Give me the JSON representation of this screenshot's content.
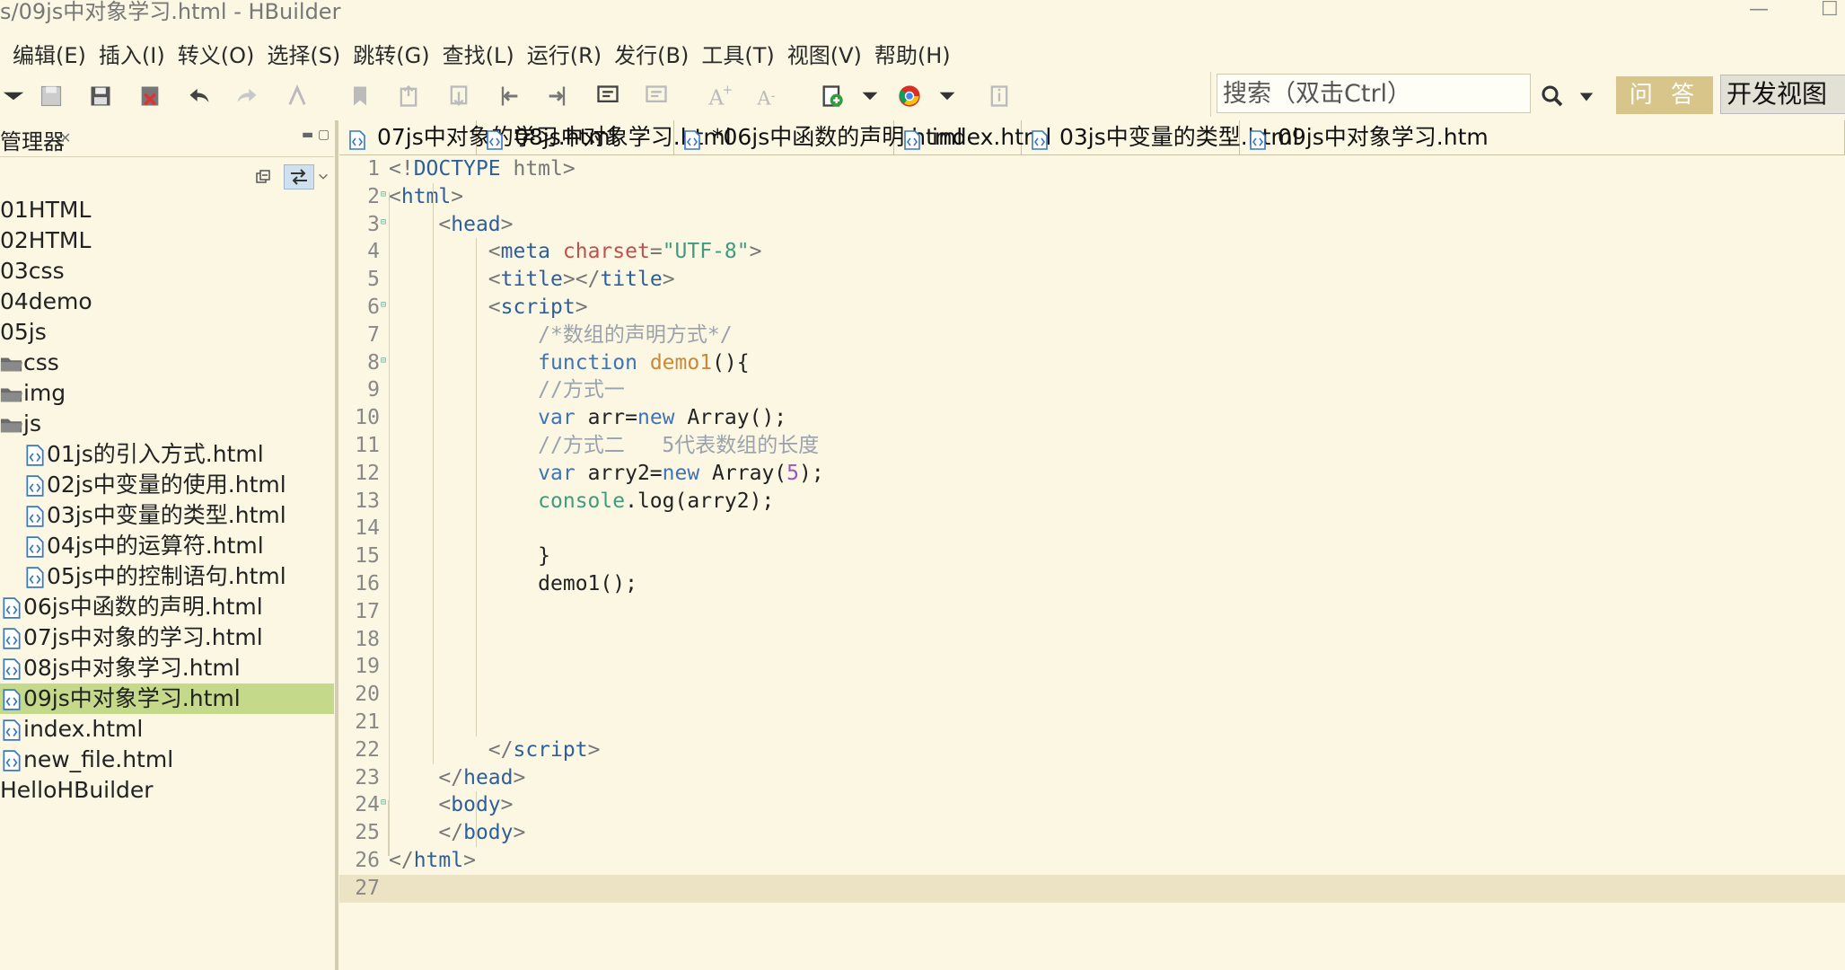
{
  "window": {
    "title": "s/09js中对象学习.html  -  HBuilder",
    "minimize": "—",
    "maximize": "☐"
  },
  "menu": [
    "编辑(E)",
    "插入(I)",
    "转义(O)",
    "选择(S)",
    "跳转(G)",
    "查找(L)",
    "运行(R)",
    "发行(B)",
    "工具(T)",
    "视图(V)",
    "帮助(H)"
  ],
  "toolbar": {
    "search_placeholder": "搜索（双击Ctrl）",
    "ask_label": "问 答",
    "devview_label": "开发视图"
  },
  "project_panel": {
    "title": "管理器",
    "close": "✕",
    "items": [
      {
        "label": "01HTML",
        "type": "project",
        "indent": 0
      },
      {
        "label": "02HTML",
        "type": "project",
        "indent": 0
      },
      {
        "label": "03css",
        "type": "project",
        "indent": 0
      },
      {
        "label": "04demo",
        "type": "project",
        "indent": 0
      },
      {
        "label": "05js",
        "type": "project",
        "indent": 0
      },
      {
        "label": "css",
        "type": "folder",
        "indent": 1
      },
      {
        "label": "img",
        "type": "folder",
        "indent": 1
      },
      {
        "label": "js",
        "type": "folder",
        "indent": 1
      },
      {
        "label": "01js的引入方式.html",
        "type": "file",
        "indent": 2
      },
      {
        "label": "02js中变量的使用.html",
        "type": "file",
        "indent": 2
      },
      {
        "label": "03js中变量的类型.html",
        "type": "file",
        "indent": 2
      },
      {
        "label": "04js中的运算符.html",
        "type": "file",
        "indent": 2
      },
      {
        "label": "05js中的控制语句.html",
        "type": "file",
        "indent": 2
      },
      {
        "label": "06js中函数的声明.html",
        "type": "file",
        "indent": 1
      },
      {
        "label": "07js中对象的学习.html",
        "type": "file",
        "indent": 1
      },
      {
        "label": "08js中对象学习.html",
        "type": "file",
        "indent": 1
      },
      {
        "label": "09js中对象学习.html",
        "type": "file",
        "indent": 1,
        "selected": true
      },
      {
        "label": "index.html",
        "type": "file",
        "indent": 1
      },
      {
        "label": "new_file.html",
        "type": "file",
        "indent": 1
      },
      {
        "label": "HelloHBuilder",
        "type": "project",
        "indent": 0
      }
    ]
  },
  "tabs": [
    {
      "label": "07js中对象的学习.html"
    },
    {
      "label": "08js中对象学习.html"
    },
    {
      "label": "*06js中函数的声明.html"
    },
    {
      "label": "index.html"
    },
    {
      "label": "03js中变量的类型.html"
    },
    {
      "label": "09js中对象学习.htm"
    }
  ],
  "editor": {
    "current_line": 27,
    "lines": [
      {
        "n": "1",
        "fold": false,
        "tokens": [
          [
            "br",
            "<!"
          ],
          [
            "tag",
            "DOCTYPE"
          ],
          [
            "br",
            " html>"
          ]
        ]
      },
      {
        "n": "2",
        "fold": true,
        "tokens": [
          [
            "br",
            "<"
          ],
          [
            "tag",
            "html"
          ],
          [
            "br",
            ">"
          ]
        ]
      },
      {
        "n": "3",
        "fold": true,
        "tokens": [
          [
            "plain",
            "    "
          ],
          [
            "br",
            "<"
          ],
          [
            "tag",
            "head"
          ],
          [
            "br",
            ">"
          ]
        ]
      },
      {
        "n": "4",
        "fold": false,
        "tokens": [
          [
            "plain",
            "        "
          ],
          [
            "br",
            "<"
          ],
          [
            "tag",
            "meta"
          ],
          [
            "plain",
            " "
          ],
          [
            "attr",
            "charset"
          ],
          [
            "br",
            "="
          ],
          [
            "str",
            "\"UTF-8\""
          ],
          [
            "br",
            ">"
          ]
        ]
      },
      {
        "n": "5",
        "fold": false,
        "tokens": [
          [
            "plain",
            "        "
          ],
          [
            "br",
            "<"
          ],
          [
            "tag",
            "title"
          ],
          [
            "br",
            "></"
          ],
          [
            "tag",
            "title"
          ],
          [
            "br",
            ">"
          ]
        ]
      },
      {
        "n": "6",
        "fold": true,
        "tokens": [
          [
            "plain",
            "        "
          ],
          [
            "br",
            "<"
          ],
          [
            "tag",
            "script"
          ],
          [
            "br",
            ">"
          ]
        ]
      },
      {
        "n": "7",
        "fold": false,
        "tokens": [
          [
            "plain",
            "            "
          ],
          [
            "cm",
            "/*数组的声明方式*/"
          ]
        ]
      },
      {
        "n": "8",
        "fold": true,
        "tokens": [
          [
            "plain",
            "            "
          ],
          [
            "kw",
            "function"
          ],
          [
            "plain",
            " "
          ],
          [
            "fn",
            "demo1"
          ],
          [
            "plain",
            "(){"
          ]
        ]
      },
      {
        "n": "9",
        "fold": false,
        "tokens": [
          [
            "plain",
            "            "
          ],
          [
            "cm",
            "//方式一"
          ]
        ]
      },
      {
        "n": "10",
        "fold": false,
        "tokens": [
          [
            "plain",
            "            "
          ],
          [
            "kw",
            "var"
          ],
          [
            "plain",
            " arr="
          ],
          [
            "kw",
            "new"
          ],
          [
            "plain",
            " Array();"
          ]
        ]
      },
      {
        "n": "11",
        "fold": false,
        "tokens": [
          [
            "plain",
            "            "
          ],
          [
            "cm",
            "//方式二   5代表数组的长度"
          ]
        ]
      },
      {
        "n": "12",
        "fold": false,
        "tokens": [
          [
            "plain",
            "            "
          ],
          [
            "kw",
            "var"
          ],
          [
            "plain",
            " arry2="
          ],
          [
            "kw",
            "new"
          ],
          [
            "plain",
            " Array("
          ],
          [
            "num",
            "5"
          ],
          [
            "plain",
            ");"
          ]
        ]
      },
      {
        "n": "13",
        "fold": false,
        "tokens": [
          [
            "plain",
            "            "
          ],
          [
            "teal",
            "console"
          ],
          [
            "plain",
            ".log(arry2);"
          ]
        ]
      },
      {
        "n": "14",
        "fold": false,
        "tokens": []
      },
      {
        "n": "15",
        "fold": false,
        "tokens": [
          [
            "plain",
            "            }"
          ]
        ]
      },
      {
        "n": "16",
        "fold": false,
        "tokens": [
          [
            "plain",
            "            demo1();"
          ]
        ]
      },
      {
        "n": "17",
        "fold": false,
        "tokens": []
      },
      {
        "n": "18",
        "fold": false,
        "tokens": []
      },
      {
        "n": "19",
        "fold": false,
        "tokens": []
      },
      {
        "n": "20",
        "fold": false,
        "tokens": []
      },
      {
        "n": "21",
        "fold": false,
        "tokens": []
      },
      {
        "n": "22",
        "fold": false,
        "tokens": [
          [
            "plain",
            "        "
          ],
          [
            "br",
            "</"
          ],
          [
            "tag",
            "script"
          ],
          [
            "br",
            ">"
          ]
        ]
      },
      {
        "n": "23",
        "fold": false,
        "tokens": [
          [
            "plain",
            "    "
          ],
          [
            "br",
            "</"
          ],
          [
            "tag",
            "head"
          ],
          [
            "br",
            ">"
          ]
        ]
      },
      {
        "n": "24",
        "fold": true,
        "tokens": [
          [
            "plain",
            "    "
          ],
          [
            "br",
            "<"
          ],
          [
            "tag",
            "body"
          ],
          [
            "br",
            ">"
          ]
        ]
      },
      {
        "n": "25",
        "fold": false,
        "tokens": [
          [
            "plain",
            "    "
          ],
          [
            "br",
            "</"
          ],
          [
            "tag",
            "body"
          ],
          [
            "br",
            ">"
          ]
        ]
      },
      {
        "n": "26",
        "fold": false,
        "tokens": [
          [
            "br",
            "</"
          ],
          [
            "tag",
            "html"
          ],
          [
            "br",
            ">"
          ]
        ]
      },
      {
        "n": "27",
        "fold": false,
        "tokens": []
      }
    ]
  }
}
